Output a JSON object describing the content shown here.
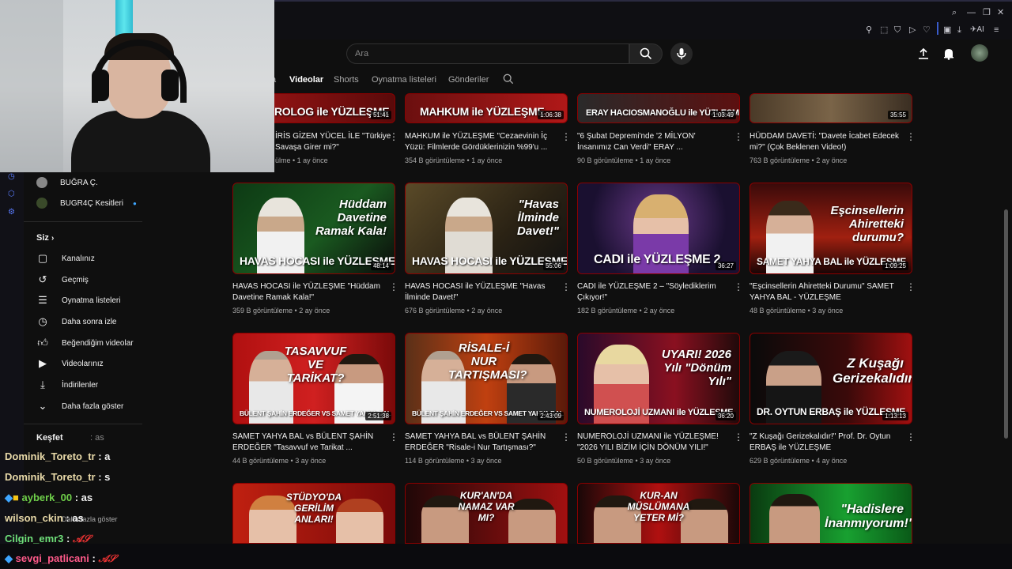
{
  "search": {
    "placeholder": "Ara"
  },
  "tabs": [
    {
      "label": "a"
    },
    {
      "label": "Videolar",
      "active": true
    },
    {
      "label": "Shorts"
    },
    {
      "label": "Oynatma listeleri"
    },
    {
      "label": "Gönderiler"
    }
  ],
  "browser": {
    "ai_label": "AI"
  },
  "sidebar": {
    "subs": [
      {
        "label": "BUĞRA Ç."
      },
      {
        "label": "BUGR4Ç Kesitleri"
      }
    ],
    "you_header": "Siz",
    "items": [
      {
        "label": "Kanalınız",
        "icon": "channel-icon"
      },
      {
        "label": "Geçmiş",
        "icon": "history-icon"
      },
      {
        "label": "Oynatma listeleri",
        "icon": "playlist-icon"
      },
      {
        "label": "Daha sonra izle",
        "icon": "clock-icon"
      },
      {
        "label": "Beğendiğim videolar",
        "icon": "thumbs-up-icon"
      },
      {
        "label": "Videolarınız",
        "icon": "video-icon"
      },
      {
        "label": "İndirilenler",
        "icon": "download-icon"
      },
      {
        "label": "Daha fazla göster",
        "icon": "chevron-down-icon"
      }
    ],
    "explore_header": "Keşfet",
    "more2": "Daha fazla göster"
  },
  "videos_row1": [
    {
      "thumb_text": "ROLOG ile YÜZLEŞME",
      "duration": "51:41",
      "title": "İRİS GİZEM YÜCEL İLE \"Türkiye Savaşa Girer mi?\"",
      "meta": "ülme • 1 ay önce"
    },
    {
      "thumb_text": "MAHKUM ile YÜZLEŞME",
      "duration": "1:06:38",
      "title": "MAHKUM ile YÜZLEŞME \"Cezaevinin İç Yüzü: Filmlerde Gördüklerinizin %99'u ...",
      "meta": "354 B görüntüleme • 1 ay önce"
    },
    {
      "thumb_text": "ERAY HACIOSMANOĞLU ile YÜZLEŞME",
      "duration": "1:03:49",
      "title": "\"6 Şubat Depremi'nde '2 MİLYON' İnsanımız Can Verdi\" ERAY ...",
      "meta": "90 B görüntüleme • 1 ay önce"
    },
    {
      "thumb_text": "",
      "duration": "35:55",
      "title": "HÜDDAM DAVETİ: \"Davete İcabet Edecek mi?\" (Çok Beklenen Video!)",
      "meta": "763 B görüntüleme • 2 ay önce"
    }
  ],
  "videos_row2": [
    {
      "thumb_text": "HAVAS HOCASI ile YÜZLEŞME",
      "big": "Hüddam Davetine Ramak Kala!",
      "duration": "48:14",
      "title": "HAVAS HOCASI ile YÜZLEŞME \"Hüddam Davetine Ramak Kala!\"",
      "meta": "359 B görüntüleme • 2 ay önce"
    },
    {
      "thumb_text": "HAVAS HOCASI ile YÜZLEŞME",
      "big": "\"Havas İlminde Davet!\"",
      "duration": "55:06",
      "title": "HAVAS HOCASI ile YÜZLEŞME \"Havas İlminde Davet!\"",
      "meta": "676 B görüntüleme • 2 ay önce"
    },
    {
      "thumb_text": "CADI ile YÜZLEŞME 2",
      "big": "",
      "duration": "36:27",
      "title": "CADI ile YÜZLEŞME 2 – \"Söylediklerim Çıkıyor!\"",
      "meta": "182 B görüntüleme • 2 ay önce"
    },
    {
      "thumb_text": "SAMET YAHYA BAL ile YÜZLEŞME",
      "big": "Eşcinsellerin Ahiretteki durumu?",
      "duration": "1:09:25",
      "title": "\"Eşcinsellerin Ahiretteki Durumu\" SAMET YAHYA BAL - YÜZLEŞME",
      "meta": "48 B görüntüleme • 3 ay önce"
    }
  ],
  "videos_row3": [
    {
      "thumb_text": "BÜLENT ŞAHİN ERDEĞER VS SAMET YAHYA BAL",
      "big": "TASAVVUF VE TARİKAT?",
      "duration": "2:51:38",
      "title": "SAMET YAHYA BAL vs BÜLENT ŞAHİN ERDEĞER \"Tasavvuf ve Tarikat ...",
      "meta": "44 B görüntüleme • 3 ay önce"
    },
    {
      "thumb_text": "BÜLENT ŞAHİN ERDEĞER VS SAMET YAHYA BAL",
      "big": "RİSALE-İ NUR TARTIŞMASI?",
      "duration": "2:43:09",
      "title": "SAMET YAHYA BAL vs BÜLENT ŞAHİN ERDEĞER \"Risale-i Nur Tartışması?\"",
      "meta": "114 B görüntüleme • 3 ay önce"
    },
    {
      "thumb_text": "NUMEROLOJİ UZMANI ile YÜZLEŞME",
      "big": "UYARI! 2026 Yılı \"Dönüm Yılı\"",
      "duration": "36:20",
      "title": "NUMEROLOJİ UZMANI ile YÜZLEŞME! \"2026 YILI BİZİM İÇİN DÖNÜM YILI!\"",
      "meta": "50 B görüntüleme • 3 ay önce"
    },
    {
      "thumb_text": "DR. OYTUN ERBAŞ ile YÜZLEŞME",
      "big": "Z Kuşağı Gerizekalıdır",
      "duration": "1:13:13",
      "title": "\"Z Kuşağı Gerizekalıdır!\" Prof. Dr. Oytun ERBAŞ ile YÜZLEŞME",
      "meta": "629 B görüntüleme • 4 ay önce"
    }
  ],
  "videos_row4": [
    {
      "big": "STÜDYO'DA GERİLİM ANLARI!"
    },
    {
      "big": "KUR'AN'DA NAMAZ VAR MI?"
    },
    {
      "big": "KUR-AN MÜSLÜMANA YETER Mİ?"
    },
    {
      "big": "\"Hadislere İnanmıyorum!\""
    }
  ],
  "chat": [
    {
      "user": "Dominik_Toreto_tr",
      "msg": ": a",
      "color": "#e8d9a8"
    },
    {
      "user": "Dominik_Toreto_tr",
      "msg": ": s",
      "color": "#e8d9a8"
    },
    {
      "user": "ayberk_00",
      "msg": ": as",
      "color": "#6fcf4a"
    },
    {
      "user": "wilson_ckin",
      "msg": ": as",
      "color": "#e8d9a8"
    },
    {
      "user": "Cilgin_emr3",
      "msg": ":",
      "color": "#6fe07a"
    },
    {
      "user": "sevgi_patlicani",
      "msg": ":",
      "color": "#ff5a8a"
    }
  ],
  "chat_faded": ": as",
  "colors": {
    "accent": "#cc0000",
    "bg": "#0f0f0f"
  }
}
